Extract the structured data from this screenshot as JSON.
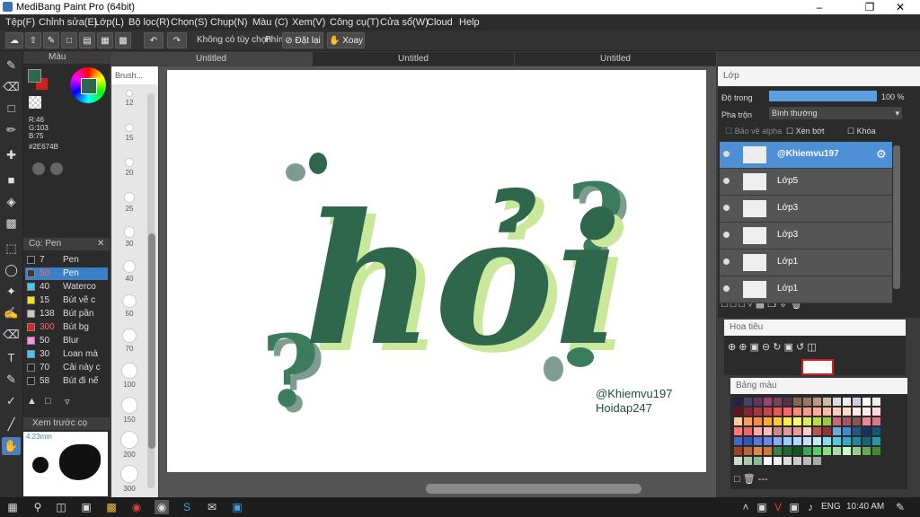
{
  "window": {
    "title": "MediBang Paint Pro (64bit)"
  },
  "menu": [
    "Tệp(F)",
    "Chỉnh sửa(E)",
    "Lớp(L)",
    "Bộ lọc(R)",
    "Chọn(S)",
    "Chụp(N)",
    "Màu (C)",
    "Xem(V)",
    "Công cụ(T)",
    "Cửa sổ(W)",
    "Cloud",
    "Help"
  ],
  "toolbar": {
    "option_text": "Không có tùy chọn",
    "shortcut_label": "Phím",
    "reset_label": "Đặt lại",
    "rotate_label": "Xoay"
  },
  "tabs": [
    "Untitled",
    "Untitled",
    "Untitled"
  ],
  "color_panel": {
    "title": "Màu",
    "r": "R:46",
    "g": "G:103",
    "b": "B:75",
    "hex": "#2E674B",
    "fg": "#2e674b",
    "bg": "#cc2222"
  },
  "brush_panel": {
    "title": "Cọ: Pen",
    "items": [
      {
        "size": "7",
        "name": "Pen",
        "color": "#222222"
      },
      {
        "size": "50",
        "name": "Pen",
        "color": "#3a3a3a"
      },
      {
        "size": "40",
        "name": "Waterco",
        "color": "#3dc9f0"
      },
      {
        "size": "15",
        "name": "Bút vẽ c",
        "color": "#f4e600"
      },
      {
        "size": "138",
        "name": "Bút pần",
        "color": "#c8c8c8"
      },
      {
        "size": "300",
        "name": "Bút bg",
        "color": "#e02020"
      },
      {
        "size": "50",
        "name": "Blur",
        "color": "#ff8fe0"
      },
      {
        "size": "30",
        "name": "Loan mà",
        "color": "#3dc9f0"
      },
      {
        "size": "70",
        "name": "Cải này c",
        "color": "#222222"
      },
      {
        "size": "58",
        "name": "Bút đi nế",
        "color": "#222222"
      }
    ]
  },
  "preview_panel": {
    "title": "Xem trước cọ",
    "size": "4.23mm"
  },
  "brush_sizes": {
    "header": "Brush...",
    "labels": [
      "12",
      "15",
      "20",
      "25",
      "30",
      "40",
      "50",
      "70",
      "100",
      "150",
      "200",
      "300"
    ]
  },
  "canvas": {
    "word": "hỏi",
    "credit_line1": "@Khiemvu197",
    "credit_line2": "Hoidap247",
    "main_color": "#2e674b",
    "shadow_color": "#c9e89a",
    "gray_color": "#7f9c90"
  },
  "layer_panel": {
    "title": "Lớp",
    "opacity_label": "Độ trong",
    "opacity_value": "100 %",
    "blend_label": "Pha trộn",
    "blend_value": "Bình thường",
    "protect_alpha": "Bảo vệ alpha",
    "clipping": "Xén bớt",
    "lock": "Khóa",
    "layers": [
      {
        "name": "@Khiemvu197",
        "selected": true
      },
      {
        "name": "Lớp5",
        "selected": false
      },
      {
        "name": "Lớp3",
        "selected": false
      },
      {
        "name": "Lớp3",
        "selected": false
      },
      {
        "name": "Lớp1",
        "selected": false
      },
      {
        "name": "Lớp1",
        "selected": false
      }
    ]
  },
  "navigator": {
    "title": "Hoa tiêu"
  },
  "palette": {
    "title": "Bảng màu",
    "footer": "---",
    "colors": [
      "#222244",
      "#444466",
      "#663366",
      "#994477",
      "#774455",
      "#553344",
      "#886655",
      "#997766",
      "#bb9988",
      "#ccbbaa",
      "#dddddd",
      "#eeeeee",
      "#ccccdd",
      "#ffffff",
      "#f0f0f0",
      "#661122",
      "#882233",
      "#aa3344",
      "#cc4444",
      "#ee5555",
      "#ff6666",
      "#ff8877",
      "#ff9988",
      "#ffaa99",
      "#ffbbaa",
      "#ffccbb",
      "#ffddcc",
      "#ffeedd",
      "#ffeeee",
      "#ffdddd",
      "#ffcc99",
      "#ff9966",
      "#ff8844",
      "#ffaa33",
      "#ffcc33",
      "#ffee44",
      "#ffff66",
      "#ddee55",
      "#bbdd44",
      "#99cc44",
      "#cc6677",
      "#aa5566",
      "#885555",
      "#ee8899",
      "#dd7788",
      "#ff7777",
      "#ee6666",
      "#ffaaaa",
      "#ffbbbb",
      "#cc8888",
      "#dd9999",
      "#ee9999",
      "#ffcccc",
      "#bb5555",
      "#993333",
      "#66aadd",
      "#4488cc",
      "#225588",
      "#113366",
      "#115577",
      "#4466cc",
      "#3355bb",
      "#5577dd",
      "#6688ee",
      "#88aaff",
      "#99ccff",
      "#aaddff",
      "#ccddff",
      "#bbeeff",
      "#88ddee",
      "#55ccdd",
      "#33aacc",
      "#228899",
      "#116677",
      "#2299aa",
      "#994422",
      "#bb6633",
      "#dd8844",
      "#cc7733",
      "#338844",
      "#226633",
      "#115522",
      "#33aa55",
      "#55cc66",
      "#88dd88",
      "#aaddaa",
      "#ccffcc",
      "#99cc88",
      "#66aa55",
      "#448833",
      "#ccddcc",
      "#aaccaa",
      "#88bb99",
      "#ffffff",
      "#eeeeee",
      "#dddddd",
      "#cccccc",
      "#bbbbbb",
      "#aaaaaa"
    ]
  },
  "taskbar": {
    "lang": "ENG",
    "time": "10:40 AM"
  }
}
